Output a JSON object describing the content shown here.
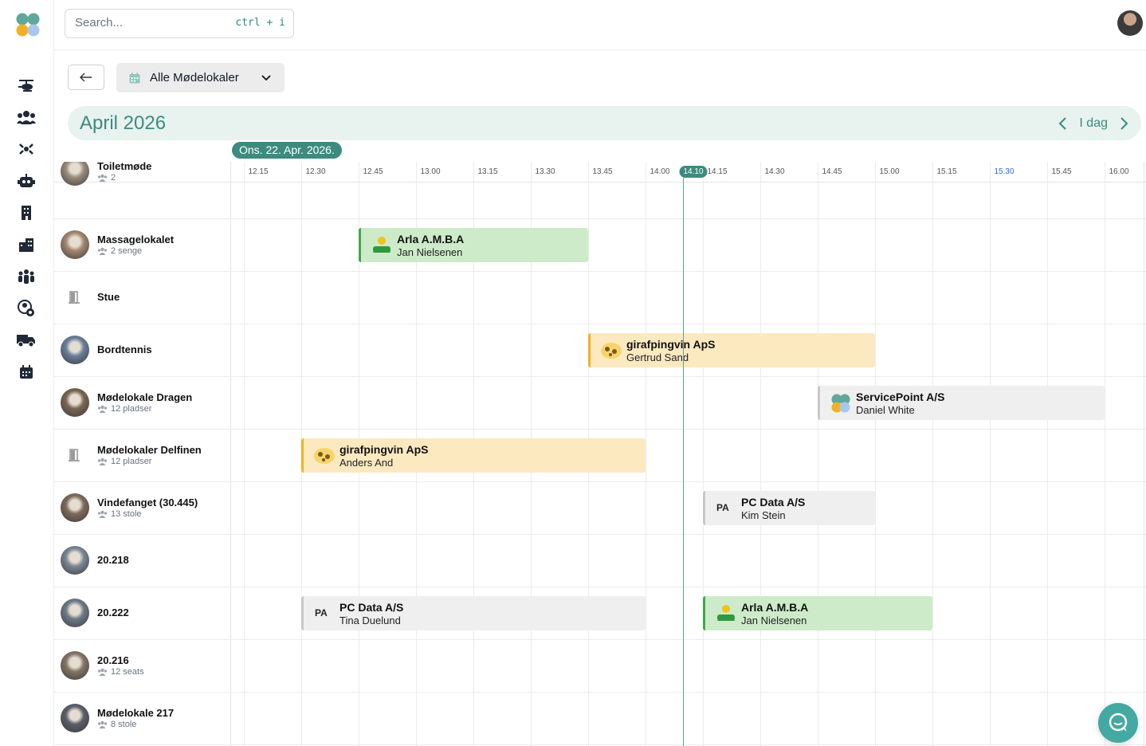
{
  "search": {
    "placeholder": "Search...",
    "shortcut": "ctrl + i"
  },
  "sidebar": {
    "items": [
      {
        "icon": "helicopter-icon"
      },
      {
        "icon": "people-icon"
      },
      {
        "icon": "connections-icon"
      },
      {
        "icon": "robot-icon"
      },
      {
        "icon": "building-icon"
      },
      {
        "icon": "city-icon"
      },
      {
        "icon": "group-icon"
      },
      {
        "icon": "user-settings-icon"
      },
      {
        "icon": "truck-icon"
      },
      {
        "icon": "calendar-icon"
      }
    ]
  },
  "toolbar": {
    "room_filter": "Alle Mødelokaler"
  },
  "calendar": {
    "month": "April 2026",
    "today_label": "I dag",
    "date_pill": "Ons. 22. Apr. 2026.",
    "now_time": "14.10",
    "highlight_time": "15.30",
    "ticks": [
      "12.15",
      "12.30",
      "12.45",
      "13.00",
      "13.15",
      "13.30",
      "13.45",
      "14.00",
      "14.15",
      "14.30",
      "14.45",
      "15.00",
      "15.15",
      "15.30",
      "15.45",
      "16.00"
    ]
  },
  "rooms": [
    {
      "name": "Toiletmøde",
      "capacity": "2"
    },
    {
      "name": "Massagelokalet",
      "capacity": "2 senge"
    },
    {
      "name": "Stue",
      "capacity": ""
    },
    {
      "name": "Bordtennis",
      "capacity": ""
    },
    {
      "name": "Mødelokale Dragen",
      "capacity": "12 pladser"
    },
    {
      "name": "Mødelokaler Delfinen",
      "capacity": "12 pladser"
    },
    {
      "name": "Vindefanget (30.445)",
      "capacity": "13 stole"
    },
    {
      "name": "20.218",
      "capacity": ""
    },
    {
      "name": "20.222",
      "capacity": ""
    },
    {
      "name": "20.216",
      "capacity": "12 seats"
    },
    {
      "name": "Mødelokale 217",
      "capacity": "8 stole"
    }
  ],
  "bookings": [
    {
      "company": "Arla A.M.B.A",
      "person": "Jan Nielsenen",
      "logo": "arla-logo-icon",
      "color": "#cdebc9"
    },
    {
      "company": "girafpingvin ApS",
      "person": "Gertrud Sand",
      "logo": "girafpingvin-logo-icon",
      "color": "#fde9c0"
    },
    {
      "company": "ServicePoint A/S",
      "person": "Daniel White",
      "logo": "servicepoint-logo-icon",
      "color": "#efefef"
    },
    {
      "company": "girafpingvin ApS",
      "person": "Anders And",
      "logo": "girafpingvin-logo-icon",
      "color": "#fde9c0"
    },
    {
      "company": "PC Data A/S",
      "person": "Kim Stein",
      "initials": "PA",
      "color": "#efefef"
    },
    {
      "company": "PC Data A/S",
      "person": "Tina Duelund",
      "initials": "PA",
      "color": "#efefef"
    },
    {
      "company": "Arla A.M.B.A",
      "person": "Jan Nielsenen",
      "logo": "arla-logo-icon",
      "color": "#cdebc9"
    }
  ],
  "colors": {
    "accent": "#3d8a7e",
    "chat": "#44a8a3"
  }
}
